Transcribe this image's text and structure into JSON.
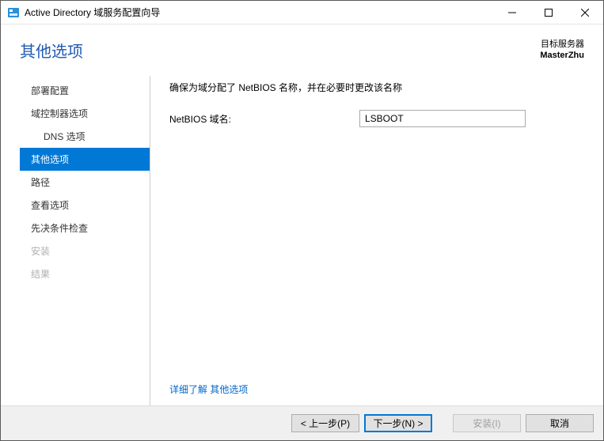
{
  "window": {
    "title": "Active Directory 域服务配置向导"
  },
  "header": {
    "page_title": "其他选项",
    "target_label": "目标服务器",
    "target_name": "MasterZhu"
  },
  "sidebar": {
    "items": [
      {
        "label": "部署配置",
        "state": "normal"
      },
      {
        "label": "域控制器选项",
        "state": "normal"
      },
      {
        "label": "DNS 选项",
        "state": "indent"
      },
      {
        "label": "其他选项",
        "state": "active"
      },
      {
        "label": "路径",
        "state": "normal"
      },
      {
        "label": "查看选项",
        "state": "normal"
      },
      {
        "label": "先决条件检查",
        "state": "normal"
      },
      {
        "label": "安装",
        "state": "disabled"
      },
      {
        "label": "结果",
        "state": "disabled"
      }
    ]
  },
  "main": {
    "instruction": "确保为域分配了 NetBIOS 名称，并在必要时更改该名称",
    "netbios_label": "NetBIOS 域名:",
    "netbios_value": "LSBOOT",
    "more_link": "详细了解 其他选项"
  },
  "footer": {
    "prev": "< 上一步(P)",
    "next": "下一步(N) >",
    "install": "安装(I)",
    "cancel": "取消"
  }
}
